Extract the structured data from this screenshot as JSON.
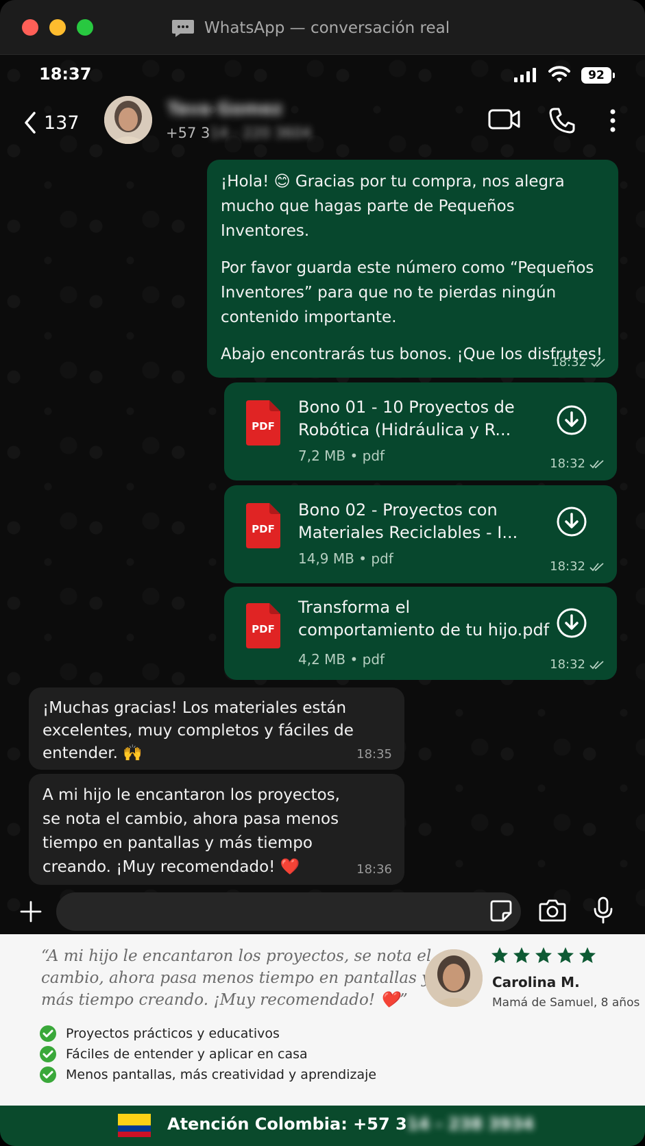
{
  "window": {
    "title": "WhatsApp — conversación real"
  },
  "status": {
    "time": "18:37",
    "battery": "92"
  },
  "header": {
    "back_count": "137",
    "contact_name": "Tava Gomez",
    "phone_prefix": "+57 3",
    "phone_hidden": "14 - 220 3604"
  },
  "messages": {
    "m1": {
      "p1_before": "¡Hola!",
      "emoji": "😊",
      "p1_after": "Gracias por tu compra, nos alegra mucho que hagas parte de Pequeños Inventores.",
      "p2": "Por favor guarda este número como “Pequeños Inventores” para que no te pierdas ningún contenido importante.",
      "p3": "Abajo encontrarás tus bonos. ¡Que los disfrutes!",
      "time": "18:32"
    },
    "files": [
      {
        "title": "Bono 01 - 10 Proyectos de Robótica (Hidráulica y R...",
        "size": "7,2 MB",
        "ext": "pdf",
        "time": "18:32"
      },
      {
        "title": "Bono 02 - Proyectos con Materiales Reciclables - I...",
        "size": "14,9 MB",
        "ext": "pdf",
        "time": "18:32"
      },
      {
        "title": "Transforma el comportamiento de tu hijo.pdf",
        "size": "4,2 MB",
        "ext": "pdf",
        "time": "18:32"
      }
    ],
    "pdf_label": "PDF",
    "in1": {
      "text": "¡Muchas gracias! Los materiales están excelentes, muy completos y fáciles de entender. 🙌",
      "time": "18:35"
    },
    "in2": {
      "text": "A mi hijo le encantaron los proyectos, se nota el cambio, ahora pasa menos tiempo en pantallas y más tiempo creando. ¡Muy recomendado! ❤️",
      "time": "18:36"
    }
  },
  "input": {
    "value": "",
    "placeholder": ""
  },
  "testimonial": {
    "quote": "“A mi hijo le encantaron los proyectos, se nota el cambio, ahora pasa menos tiempo en pantallas y más tiempo creando. ¡Muy recomendado! ❤️”",
    "rating": 5,
    "name": "Carolina M.",
    "subtitle": "Mamá de Samuel, 8 años",
    "checks": [
      "Proyectos prácticos y educativos",
      "Fáciles de entender y aplicar en casa",
      "Menos pantallas, más creatividad y aprendizaje"
    ]
  },
  "footer": {
    "text": "Atención Colombia: +57 3",
    "hidden": "14 - 238 3934"
  },
  "colors": {
    "accent": "#07472d",
    "footer": "#0a4a2c",
    "check": "#3aa83a",
    "star": "#0e5a34"
  }
}
